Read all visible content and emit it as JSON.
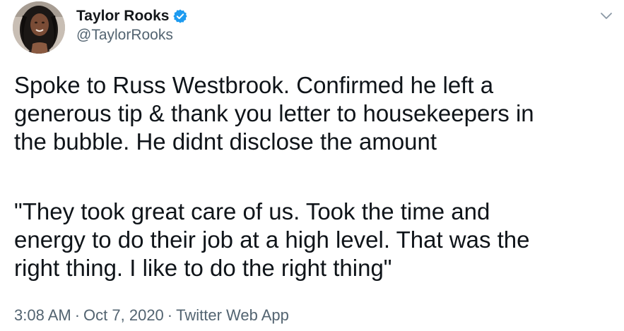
{
  "author": {
    "display_name": "Taylor Rooks",
    "handle": "@TaylorRooks",
    "verified": true,
    "verified_icon": "verified-badge-icon",
    "avatar_icon": "profile-photo"
  },
  "header": {
    "menu_icon": "chevron-down-icon"
  },
  "tweet": {
    "paragraph1": [
      "Spoke to Russ Westbrook. Confirmed he left a",
      "generous tip & thank you letter to housekeepers in",
      "the bubble. He didnt disclose the amount"
    ],
    "paragraph2": [
      "\"They took great care of us. Took the time and",
      "energy to do their job at a high level. That was the",
      "right thing. I like to do the right thing\""
    ]
  },
  "meta": {
    "time": "3:08 AM",
    "separator": "·",
    "date": "Oct 7, 2020",
    "source": "Twitter Web App"
  },
  "colors": {
    "accent": "#1d9bf0",
    "text": "#0f1419",
    "secondary_text": "#536471",
    "background": "#ffffff"
  }
}
